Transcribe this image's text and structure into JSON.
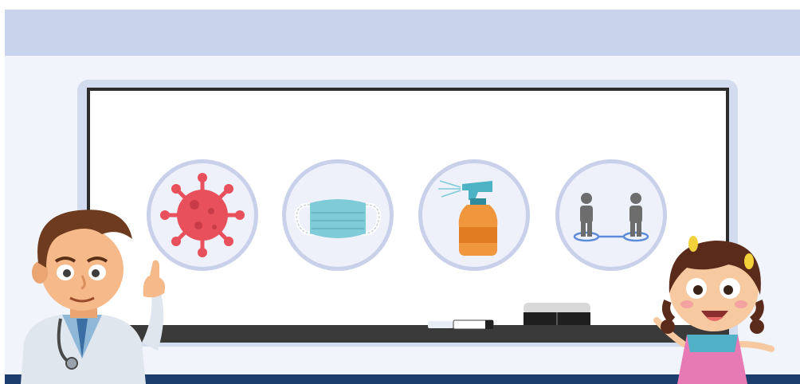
{
  "scene": {
    "icons": [
      {
        "name": "virus-icon"
      },
      {
        "name": "face-mask-icon"
      },
      {
        "name": "spray-bottle-icon"
      },
      {
        "name": "social-distance-icon"
      }
    ],
    "characters": [
      "doctor",
      "girl"
    ],
    "colors": {
      "top_band": "#c9d3eb",
      "wall": "#f1f4fb",
      "floor": "#1b3e6e",
      "board_frame": "#d3dbef",
      "virus": "#e8505b",
      "mask": "#7fcbd8",
      "bottle": "#f0963c",
      "person": "#6d6d6d",
      "distance_ring": "#5b8bd9"
    }
  }
}
